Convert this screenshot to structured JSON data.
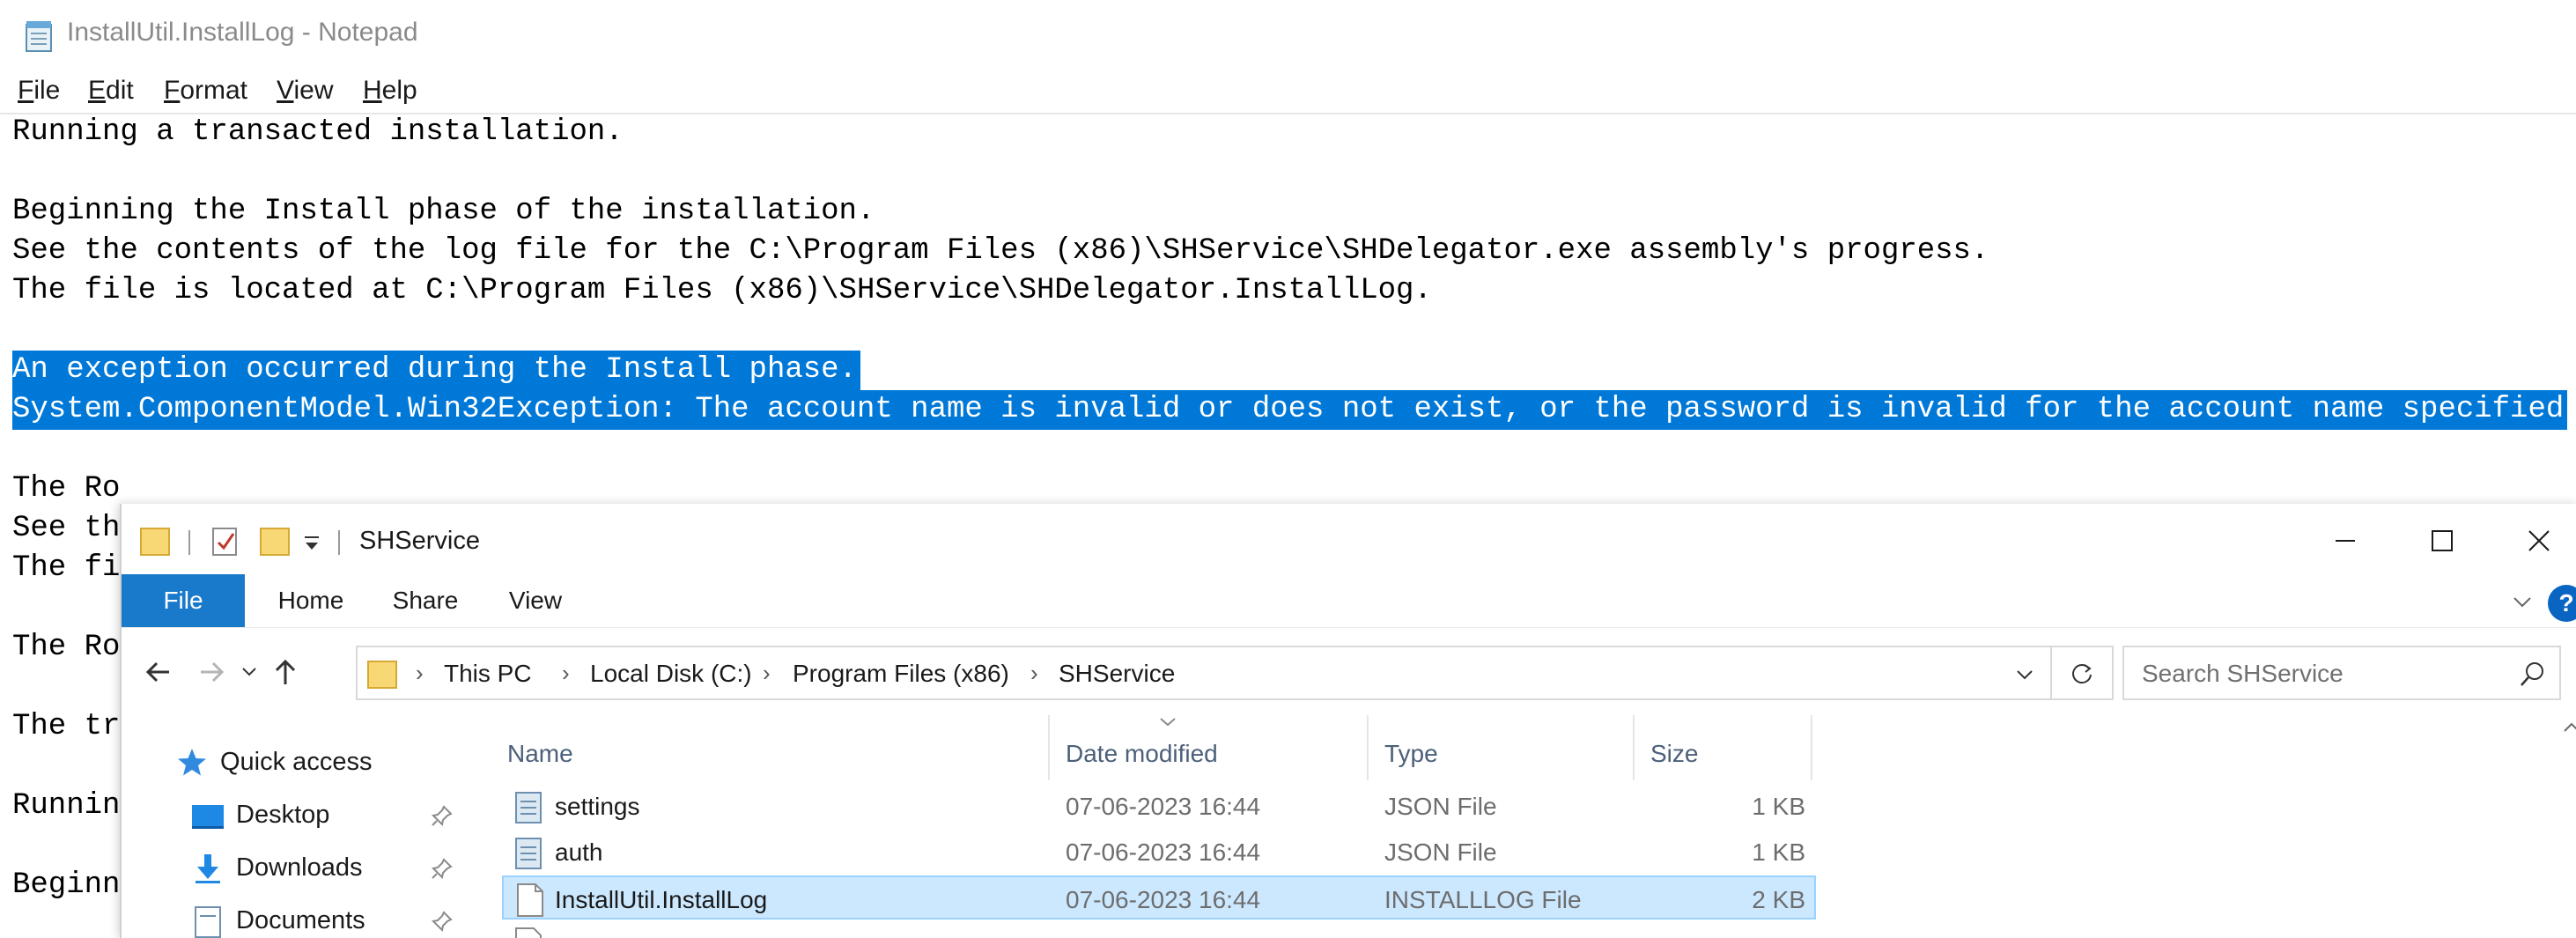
{
  "notepad": {
    "title": "InstallUtil.InstallLog - Notepad",
    "menu": [
      "File",
      "Edit",
      "Format",
      "View",
      "Help"
    ],
    "lines": [
      "Running a transacted installation.",
      "",
      "Beginning the Install phase of the installation.",
      "See the contents of the log file for the C:\\Program Files (x86)\\SHService\\SHDelegator.exe assembly's progress.",
      "The file is located at C:\\Program Files (x86)\\SHService\\SHDelegator.InstallLog.",
      "",
      "An exception occurred during the Install phase.",
      "System.ComponentModel.Win32Exception: The account name is invalid or does not exist, or the password is invalid for the account name specified",
      "",
      "The Ro",
      "See th",
      "The fi",
      "",
      "The Ro",
      "",
      "The tr",
      "",
      "Runnin",
      "",
      "Beginn"
    ],
    "selected_lines": [
      6,
      7
    ],
    "selection_color": "#0078d7"
  },
  "explorer": {
    "title": "SHService",
    "ribbon_tabs": [
      "File",
      "Home",
      "Share",
      "View"
    ],
    "active_tab": "File",
    "accent": "#1979ca",
    "breadcrumb": [
      "This PC",
      "Local Disk (C:)",
      "Program Files (x86)",
      "SHService"
    ],
    "search_placeholder": "Search SHService",
    "nav_items": [
      {
        "label": "Quick access",
        "icon": "star-icon",
        "pinned": false
      },
      {
        "label": "Desktop",
        "icon": "desktop-icon",
        "pinned": true
      },
      {
        "label": "Downloads",
        "icon": "download-icon",
        "pinned": true
      },
      {
        "label": "Documents",
        "icon": "documents-icon",
        "pinned": true
      }
    ],
    "columns": [
      "Name",
      "Date modified",
      "Type",
      "Size"
    ],
    "files": [
      {
        "name": "settings",
        "date": "07-06-2023 16:44",
        "type": "JSON File",
        "size": "1 KB",
        "icon": "json-file-icon",
        "selected": false
      },
      {
        "name": "auth",
        "date": "07-06-2023 16:44",
        "type": "JSON File",
        "size": "1 KB",
        "icon": "json-file-icon",
        "selected": false
      },
      {
        "name": "InstallUtil.InstallLog",
        "date": "07-06-2023 16:44",
        "type": "INSTALLLOG File",
        "size": "2 KB",
        "icon": "file-icon",
        "selected": true
      }
    ]
  }
}
